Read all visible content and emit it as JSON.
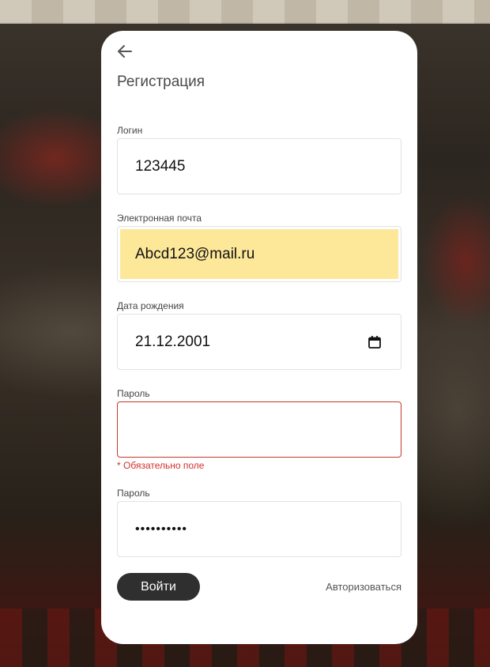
{
  "form": {
    "title": "Регистрация",
    "back_icon": "arrow-left-icon",
    "login": {
      "label": "Логин",
      "value": "123445"
    },
    "email": {
      "label": "Электронная почта",
      "value": "Abcd123@mail.ru"
    },
    "birthdate": {
      "label": "Дата рождения",
      "value": "21.12.2001",
      "icon": "calendar-icon"
    },
    "password": {
      "label": "Пароль",
      "value": "",
      "error": "* Обязательно поле"
    },
    "password_confirm": {
      "label": "Пароль",
      "value": "••••••••••"
    },
    "submit_label": "Войти",
    "auth_link": "Авторизоваться"
  },
  "colors": {
    "button_bg": "#2f2f2f",
    "autofill_bg": "#fde89a",
    "error": "#d32f2f"
  }
}
